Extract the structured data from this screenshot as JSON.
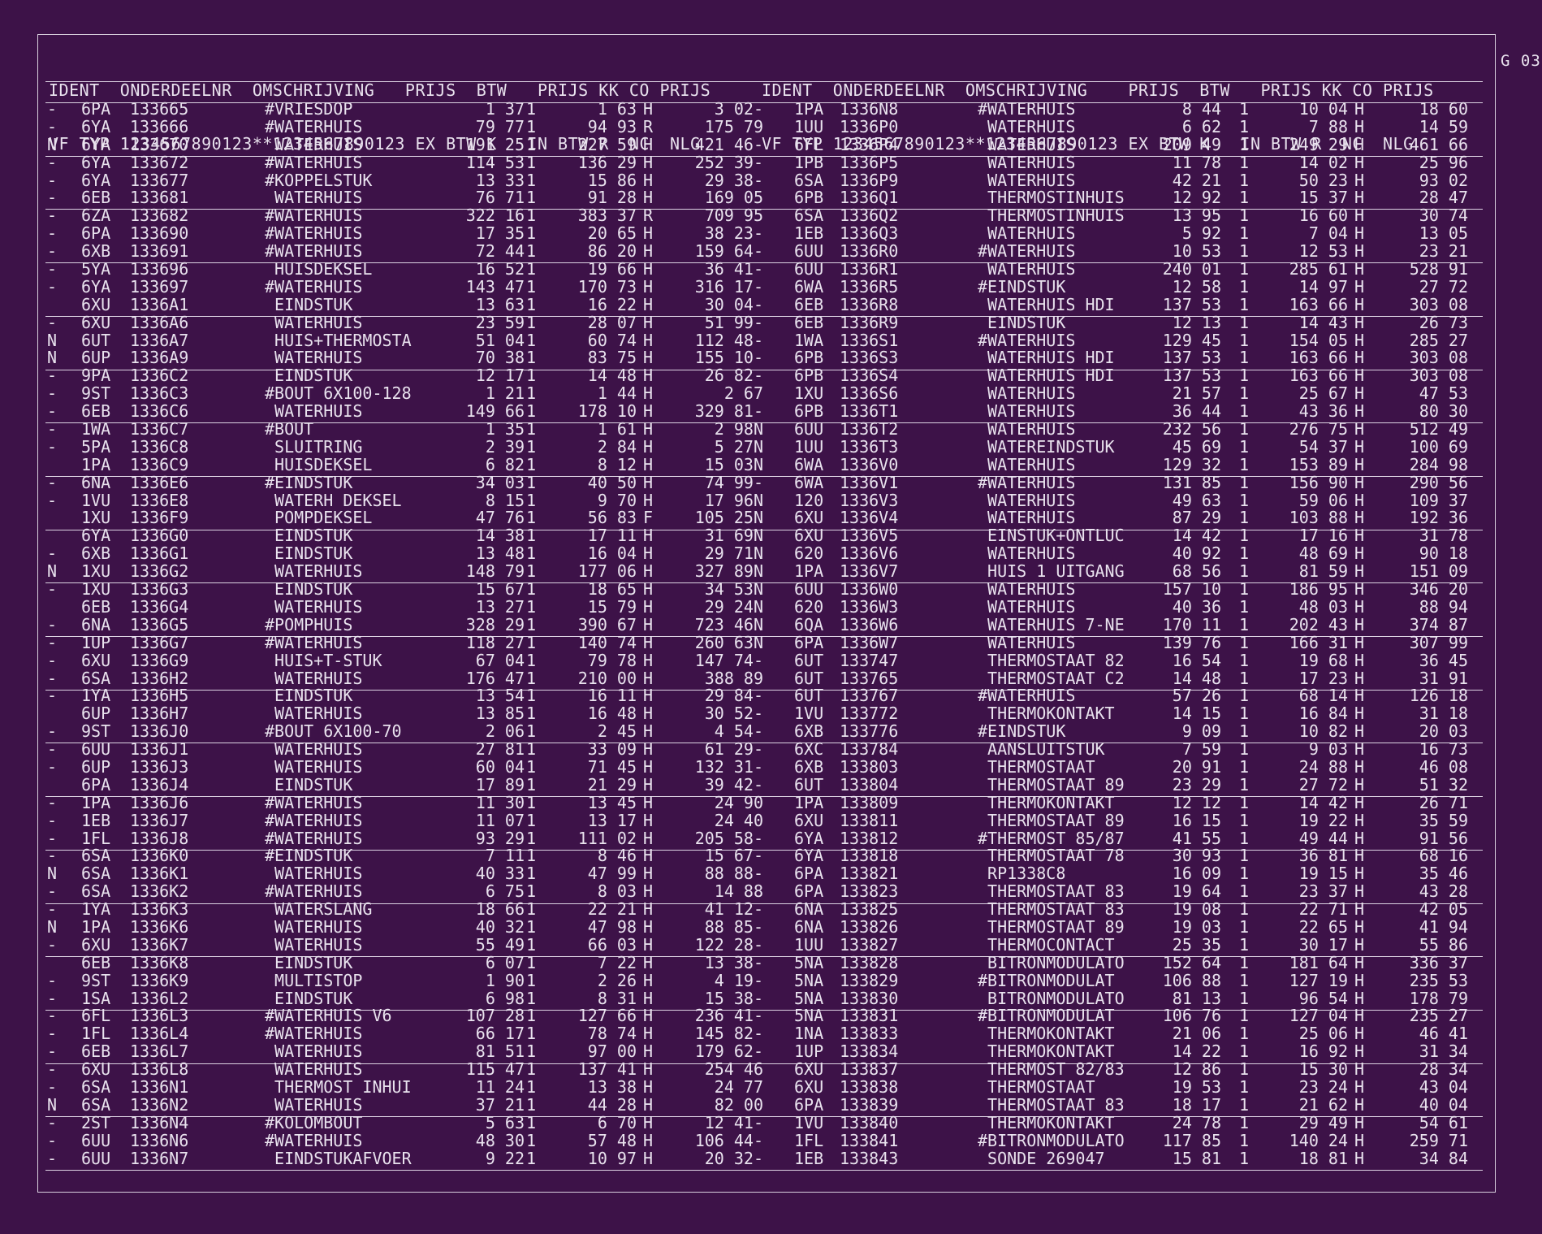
{
  "corner_label": "G 03",
  "header": {
    "left": {
      "line1": "IDENT  ONDERDEELNR  OMSCHRIJVING   PRIJS  BTW   PRIJS KK CO PRIJS",
      "line2": "VF TYP 1234567890123**1234567890123 EX BTW K   IN BTW R  NC  NLG"
    },
    "right": {
      "line1": "IDENT  ONDERDEELNR  OMSCHRIJVING    PRIJS  BTW   PRIJS KK CO PRIJS",
      "line2": "VF TYP 1234567890123**1234567890123 EX BTW K   IN BTW R  NC  NLG"
    }
  },
  "left_rows": [
    [
      "-",
      "6PA",
      "133665",
      "#VRIESDOP",
      "1 37",
      "1",
      "1 63",
      "H",
      "3 02-"
    ],
    [
      "-",
      "6YA",
      "133666",
      "#WATERHUIS",
      "79 77",
      "1",
      "94 93",
      "R",
      "175 79"
    ],
    [
      "N",
      "6YA",
      "133670",
      " WATERHUIS",
      "191 25",
      "1",
      "227 59",
      "H",
      "421 46-"
    ],
    [
      "-",
      "6YA",
      "133672",
      "#WATERHUIS",
      "114 53",
      "1",
      "136 29",
      "H",
      "252 39-"
    ],
    [
      "-",
      "6YA",
      "133677",
      "#KOPPELSTUK",
      "13 33",
      "1",
      "15 86",
      "H",
      "29 38-"
    ],
    [
      "-",
      "6EB",
      "133681",
      " WATERHUIS",
      "76 71",
      "1",
      "91 28",
      "H",
      "169 05"
    ],
    [
      "-",
      "6ZA",
      "133682",
      "#WATERHUIS",
      "322 16",
      "1",
      "383 37",
      "R",
      "709 95"
    ],
    [
      "-",
      "6PA",
      "133690",
      "#WATERHUIS",
      "17 35",
      "1",
      "20 65",
      "H",
      "38 23-"
    ],
    [
      "-",
      "6XB",
      "133691",
      "#WATERHUIS",
      "72 44",
      "1",
      "86 20",
      "H",
      "159 64-"
    ],
    [
      "-",
      "5YA",
      "133696",
      " HUISDEKSEL",
      "16 52",
      "1",
      "19 66",
      "H",
      "36 41-"
    ],
    [
      "-",
      "6YA",
      "133697",
      "#WATERHUIS",
      "143 47",
      "1",
      "170 73",
      "H",
      "316 17-"
    ],
    [
      "",
      "6XU",
      "1336A1",
      " EINDSTUK",
      "13 63",
      "1",
      "16 22",
      "H",
      "30 04-"
    ],
    [
      "-",
      "6XU",
      "1336A6",
      " WATERHUIS",
      "23 59",
      "1",
      "28 07",
      "H",
      "51 99-"
    ],
    [
      "N",
      "6UT",
      "1336A7",
      " HUIS+THERMOSTA",
      "51 04",
      "1",
      "60 74",
      "H",
      "112 48-"
    ],
    [
      "N",
      "6UP",
      "1336A9",
      " WATERHUIS",
      "70 38",
      "1",
      "83 75",
      "H",
      "155 10-"
    ],
    [
      "-",
      "9PA",
      "1336C2",
      " EINDSTUK",
      "12 17",
      "1",
      "14 48",
      "H",
      "26 82-"
    ],
    [
      "-",
      "9ST",
      "1336C3",
      "#BOUT 6X100-128",
      "1 21",
      "1",
      "1 44",
      "H",
      "2 67"
    ],
    [
      "-",
      "6EB",
      "1336C6",
      " WATERHUIS",
      "149 66",
      "1",
      "178 10",
      "H",
      "329 81-"
    ],
    [
      "-",
      "1WA",
      "1336C7",
      "#BOUT",
      "1 35",
      "1",
      "1 61",
      "H",
      "2 98N"
    ],
    [
      "-",
      "5PA",
      "1336C8",
      " SLUITRING",
      "2 39",
      "1",
      "2 84",
      "H",
      "5 27N"
    ],
    [
      "",
      "1PA",
      "1336C9",
      " HUISDEKSEL",
      "6 82",
      "1",
      "8 12",
      "H",
      "15 03N"
    ],
    [
      "-",
      "6NA",
      "1336E6",
      "#EINDSTUK",
      "34 03",
      "1",
      "40 50",
      "H",
      "74 99-"
    ],
    [
      "-",
      "1VU",
      "1336E8",
      " WATERH DEKSEL",
      "8 15",
      "1",
      "9 70",
      "H",
      "17 96N"
    ],
    [
      "",
      "1XU",
      "1336F9",
      " POMPDEKSEL",
      "47 76",
      "1",
      "56 83",
      "F",
      "105 25N"
    ],
    [
      "",
      "6YA",
      "1336G0",
      " EINDSTUK",
      "14 38",
      "1",
      "17 11",
      "H",
      "31 69N"
    ],
    [
      "-",
      "6XB",
      "1336G1",
      " EINDSTUK",
      "13 48",
      "1",
      "16 04",
      "H",
      "29 71N"
    ],
    [
      "N",
      "1XU",
      "1336G2",
      " WATERHUIS",
      "148 79",
      "1",
      "177 06",
      "H",
      "327 89N"
    ],
    [
      "-",
      "1XU",
      "1336G3",
      " EINDSTUK",
      "15 67",
      "1",
      "18 65",
      "H",
      "34 53N"
    ],
    [
      "",
      "6EB",
      "1336G4",
      " WATERHUIS",
      "13 27",
      "1",
      "15 79",
      "H",
      "29 24N"
    ],
    [
      "-",
      "6NA",
      "1336G5",
      "#POMPHUIS",
      "328 29",
      "1",
      "390 67",
      "H",
      "723 46N"
    ],
    [
      "-",
      "1UP",
      "1336G7",
      "#WATERHUIS",
      "118 27",
      "1",
      "140 74",
      "H",
      "260 63N"
    ],
    [
      "-",
      "6XU",
      "1336G9",
      " HUIS+T-STUK",
      "67 04",
      "1",
      "79 78",
      "H",
      "147 74-"
    ],
    [
      "-",
      "6SA",
      "1336H2",
      " WATERHUIS",
      "176 47",
      "1",
      "210 00",
      "H",
      "388 89"
    ],
    [
      "-",
      "1YA",
      "1336H5",
      " EINDSTUK",
      "13 54",
      "1",
      "16 11",
      "H",
      "29 84-"
    ],
    [
      "",
      "6UP",
      "1336H7",
      " WATERHUIS",
      "13 85",
      "1",
      "16 48",
      "H",
      "30 52-"
    ],
    [
      "-",
      "9ST",
      "1336J0",
      "#BOUT 6X100-70",
      "2 06",
      "1",
      "2 45",
      "H",
      "4 54-"
    ],
    [
      "-",
      "6UU",
      "1336J1",
      " WATERHUIS",
      "27 81",
      "1",
      "33 09",
      "H",
      "61 29-"
    ],
    [
      "-",
      "6UP",
      "1336J3",
      " WATERHUIS",
      "60 04",
      "1",
      "71 45",
      "H",
      "132 31-"
    ],
    [
      "",
      "6PA",
      "1336J4",
      " EINDSTUK",
      "17 89",
      "1",
      "21 29",
      "H",
      "39 42-"
    ],
    [
      "-",
      "1PA",
      "1336J6",
      "#WATERHUIS",
      "11 30",
      "1",
      "13 45",
      "H",
      "24 90"
    ],
    [
      "-",
      "1EB",
      "1336J7",
      "#WATERHUIS",
      "11 07",
      "1",
      "13 17",
      "H",
      "24 40"
    ],
    [
      "-",
      "1FL",
      "1336J8",
      "#WATERHUIS",
      "93 29",
      "1",
      "111 02",
      "H",
      "205 58-"
    ],
    [
      "-",
      "6SA",
      "1336K0",
      "#EINDSTUK",
      "7 11",
      "1",
      "8 46",
      "H",
      "15 67-"
    ],
    [
      "N",
      "6SA",
      "1336K1",
      " WATERHUIS",
      "40 33",
      "1",
      "47 99",
      "H",
      "88 88-"
    ],
    [
      "-",
      "6SA",
      "1336K2",
      "#WATERHUIS",
      "6 75",
      "1",
      "8 03",
      "H",
      "14 88"
    ],
    [
      "-",
      "1YA",
      "1336K3",
      " WATERSLANG",
      "18 66",
      "1",
      "22 21",
      "H",
      "41 12-"
    ],
    [
      "N",
      "1PA",
      "1336K6",
      " WATERHUIS",
      "40 32",
      "1",
      "47 98",
      "H",
      "88 85-"
    ],
    [
      "-",
      "6XU",
      "1336K7",
      " WATERHUIS",
      "55 49",
      "1",
      "66 03",
      "H",
      "122 28-"
    ],
    [
      "",
      "6EB",
      "1336K8",
      " EINDSTUK",
      "6 07",
      "1",
      "7 22",
      "H",
      "13 38-"
    ],
    [
      "-",
      "9ST",
      "1336K9",
      " MULTISTOP",
      "1 90",
      "1",
      "2 26",
      "H",
      "4 19-"
    ],
    [
      "-",
      "1SA",
      "1336L2",
      " EINDSTUK",
      "6 98",
      "1",
      "8 31",
      "H",
      "15 38-"
    ],
    [
      "-",
      "6FL",
      "1336L3",
      "#WATERHUIS V6",
      "107 28",
      "1",
      "127 66",
      "H",
      "236 41-"
    ],
    [
      "-",
      "1FL",
      "1336L4",
      "#WATERHUIS",
      "66 17",
      "1",
      "78 74",
      "H",
      "145 82-"
    ],
    [
      "-",
      "6EB",
      "1336L7",
      " WATERHUIS",
      "81 51",
      "1",
      "97 00",
      "H",
      "179 62-"
    ],
    [
      "-",
      "6XU",
      "1336L8",
      " WATERHUIS",
      "115 47",
      "1",
      "137 41",
      "H",
      "254 46"
    ],
    [
      "-",
      "6SA",
      "1336N1",
      " THERMOST INHUI",
      "11 24",
      "1",
      "13 38",
      "H",
      "24 77"
    ],
    [
      "N",
      "6SA",
      "1336N2",
      " WATERHUIS",
      "37 21",
      "1",
      "44 28",
      "H",
      "82 00"
    ],
    [
      "-",
      "2ST",
      "1336N4",
      "#KOLOMBOUT",
      "5 63",
      "1",
      "6 70",
      "H",
      "12 41-"
    ],
    [
      "-",
      "6UU",
      "1336N6",
      "#WATERHUIS",
      "48 30",
      "1",
      "57 48",
      "H",
      "106 44-"
    ],
    [
      "-",
      "6UU",
      "1336N7",
      " EINDSTUKAFVOER",
      "9 22",
      "1",
      "10 97",
      "H",
      "20 32-"
    ]
  ],
  "right_rows": [
    [
      "1PA",
      "1336N8",
      "#WATERHUIS",
      "8 44",
      "1",
      "10 04",
      "H",
      "18 60"
    ],
    [
      "1UU",
      "1336P0",
      " WATERHUIS",
      "6 62",
      "1",
      "7 88",
      "H",
      "14 59"
    ],
    [
      "6FL",
      "1336P4",
      " WATERHUIS",
      "209 49",
      "1",
      "249 29",
      "H",
      "461 66"
    ],
    [
      "1PB",
      "1336P5",
      " WATERHUIS",
      "11 78",
      "1",
      "14 02",
      "H",
      "25 96"
    ],
    [
      "6SA",
      "1336P9",
      " WATERHUIS",
      "42 21",
      "1",
      "50 23",
      "H",
      "93 02"
    ],
    [
      "6PB",
      "1336Q1",
      " THERMOSTINHUIS",
      "12 92",
      "1",
      "15 37",
      "H",
      "28 47"
    ],
    [
      "6SA",
      "1336Q2",
      " THERMOSTINHUIS",
      "13 95",
      "1",
      "16 60",
      "H",
      "30 74"
    ],
    [
      "1EB",
      "1336Q3",
      " WATERHUIS",
      "5 92",
      "1",
      "7 04",
      "H",
      "13 05"
    ],
    [
      "6UU",
      "1336R0",
      "#WATERHUIS",
      "10 53",
      "1",
      "12 53",
      "H",
      "23 21"
    ],
    [
      "6UU",
      "1336R1",
      " WATERHUIS",
      "240 01",
      "1",
      "285 61",
      "H",
      "528 91"
    ],
    [
      "6WA",
      "1336R5",
      "#EINDSTUK",
      "12 58",
      "1",
      "14 97",
      "H",
      "27 72"
    ],
    [
      "6EB",
      "1336R8",
      " WATERHUIS HDI",
      "137 53",
      "1",
      "163 66",
      "H",
      "303 08"
    ],
    [
      "6EB",
      "1336R9",
      " EINDSTUK",
      "12 13",
      "1",
      "14 43",
      "H",
      "26 73"
    ],
    [
      "1WA",
      "1336S1",
      "#WATERHUIS",
      "129 45",
      "1",
      "154 05",
      "H",
      "285 27"
    ],
    [
      "6PB",
      "1336S3",
      " WATERHUIS HDI",
      "137 53",
      "1",
      "163 66",
      "H",
      "303 08"
    ],
    [
      "6PB",
      "1336S4",
      " WATERHUIS HDI",
      "137 53",
      "1",
      "163 66",
      "H",
      "303 08"
    ],
    [
      "1XU",
      "1336S6",
      " WATERHUIS",
      "21 57",
      "1",
      "25 67",
      "H",
      "47 53"
    ],
    [
      "6PB",
      "1336T1",
      " WATERHUIS",
      "36 44",
      "1",
      "43 36",
      "H",
      "80 30"
    ],
    [
      "6UU",
      "1336T2",
      " WATERHUIS",
      "232 56",
      "1",
      "276 75",
      "H",
      "512 49"
    ],
    [
      "1UU",
      "1336T3",
      " WATEREINDSTUK",
      "45 69",
      "1",
      "54 37",
      "H",
      "100 69"
    ],
    [
      "6WA",
      "1336V0",
      " WATERHUIS",
      "129 32",
      "1",
      "153 89",
      "H",
      "284 98"
    ],
    [
      "6WA",
      "1336V1",
      "#WATERHUIS",
      "131 85",
      "1",
      "156 90",
      "H",
      "290 56"
    ],
    [
      "120",
      "1336V3",
      " WATERHUIS",
      "49 63",
      "1",
      "59 06",
      "H",
      "109 37"
    ],
    [
      "6XU",
      "1336V4",
      " WATERHUIS",
      "87 29",
      "1",
      "103 88",
      "H",
      "192 36"
    ],
    [
      "6XU",
      "1336V5",
      " EINSTUK+ONTLUC",
      "14 42",
      "1",
      "17 16",
      "H",
      "31 78"
    ],
    [
      "620",
      "1336V6",
      " WATERHUIS",
      "40 92",
      "1",
      "48 69",
      "H",
      "90 18"
    ],
    [
      "1PA",
      "1336V7",
      " HUIS 1 UITGANG",
      "68 56",
      "1",
      "81 59",
      "H",
      "151 09"
    ],
    [
      "6UU",
      "1336W0",
      " WATERHUIS",
      "157 10",
      "1",
      "186 95",
      "H",
      "346 20"
    ],
    [
      "620",
      "1336W3",
      " WATERHUIS",
      "40 36",
      "1",
      "48 03",
      "H",
      "88 94"
    ],
    [
      "6QA",
      "1336W6",
      " WATERHUIS 7-NE",
      "170 11",
      "1",
      "202 43",
      "H",
      "374 87"
    ],
    [
      "6PA",
      "1336W7",
      " WATERHUIS",
      "139 76",
      "1",
      "166 31",
      "H",
      "307 99"
    ],
    [
      "6UT",
      "133747",
      " THERMOSTAAT 82",
      "16 54",
      "1",
      "19 68",
      "H",
      "36 45"
    ],
    [
      "6UT",
      "133765",
      " THERMOSTAAT C2",
      "14 48",
      "1",
      "17 23",
      "H",
      "31 91"
    ],
    [
      "6UT",
      "133767",
      "#WATERHUIS",
      "57 26",
      "1",
      "68 14",
      "H",
      "126 18"
    ],
    [
      "1VU",
      "133772",
      " THERMOKONTAKT",
      "14 15",
      "1",
      "16 84",
      "H",
      "31 18"
    ],
    [
      "6XB",
      "133776",
      "#EINDSTUK",
      "9 09",
      "1",
      "10 82",
      "H",
      "20 03"
    ],
    [
      "6XC",
      "133784",
      " AANSLUITSTUK",
      "7 59",
      "1",
      "9 03",
      "H",
      "16 73"
    ],
    [
      "6XB",
      "133803",
      " THERMOSTAAT",
      "20 91",
      "1",
      "24 88",
      "H",
      "46 08"
    ],
    [
      "6UT",
      "133804",
      " THERMOSTAAT 89",
      "23 29",
      "1",
      "27 72",
      "H",
      "51 32"
    ],
    [
      "1PA",
      "133809",
      " THERMOKONTAKT",
      "12 12",
      "1",
      "14 42",
      "H",
      "26 71"
    ],
    [
      "6XU",
      "133811",
      " THERMOSTAAT 89",
      "16 15",
      "1",
      "19 22",
      "H",
      "35 59"
    ],
    [
      "6YA",
      "133812",
      "#THERMOST 85/87",
      "41 55",
      "1",
      "49 44",
      "H",
      "91 56"
    ],
    [
      "6YA",
      "133818",
      " THERMOSTAAT 78",
      "30 93",
      "1",
      "36 81",
      "H",
      "68 16"
    ],
    [
      "6PA",
      "133821",
      " RP1338C8",
      "16 09",
      "1",
      "19 15",
      "H",
      "35 46"
    ],
    [
      "6PA",
      "133823",
      " THERMOSTAAT 83",
      "19 64",
      "1",
      "23 37",
      "H",
      "43 28"
    ],
    [
      "6NA",
      "133825",
      " THERMOSTAAT 83",
      "19 08",
      "1",
      "22 71",
      "H",
      "42 05"
    ],
    [
      "6NA",
      "133826",
      " THERMOSTAAT 89",
      "19 03",
      "1",
      "22 65",
      "H",
      "41 94"
    ],
    [
      "1UU",
      "133827",
      " THERMOCONTACT",
      "25 35",
      "1",
      "30 17",
      "H",
      "55 86"
    ],
    [
      "5NA",
      "133828",
      " BITRONMODULATO",
      "152 64",
      "1",
      "181 64",
      "H",
      "336 37"
    ],
    [
      "5NA",
      "133829",
      "#BITRONMODULAT",
      "106 88",
      "1",
      "127 19",
      "H",
      "235 53"
    ],
    [
      "5NA",
      "133830",
      " BITRONMODULATO",
      "81 13",
      "1",
      "96 54",
      "H",
      "178 79"
    ],
    [
      "5NA",
      "133831",
      "#BITRONMODULAT",
      "106 76",
      "1",
      "127 04",
      "H",
      "235 27"
    ],
    [
      "1NA",
      "133833",
      " THERMOKONTAKT",
      "21 06",
      "1",
      "25 06",
      "H",
      "46 41"
    ],
    [
      "1UP",
      "133834",
      " THERMOKONTAKT",
      "14 22",
      "1",
      "16 92",
      "H",
      "31 34"
    ],
    [
      "6XU",
      "133837",
      " THERMOST 82/83",
      "12 86",
      "1",
      "15 30",
      "H",
      "28 34"
    ],
    [
      "6XU",
      "133838",
      " THERMOSTAAT",
      "19 53",
      "1",
      "23 24",
      "H",
      "43 04"
    ],
    [
      "6PA",
      "133839",
      " THERMOSTAAT 83",
      "18 17",
      "1",
      "21 62",
      "H",
      "40 04"
    ],
    [
      "1VU",
      "133840",
      " THERMOKONTAKT",
      "24 78",
      "1",
      "29 49",
      "H",
      "54 61"
    ],
    [
      "1FL",
      "133841",
      "#BITRONMODULATO",
      "117 85",
      "1",
      "140 24",
      "H",
      "259 71"
    ],
    [
      "1EB",
      "133843",
      " SONDE 269047",
      "15 81",
      "1",
      "18 81",
      "H",
      "34 84"
    ]
  ]
}
